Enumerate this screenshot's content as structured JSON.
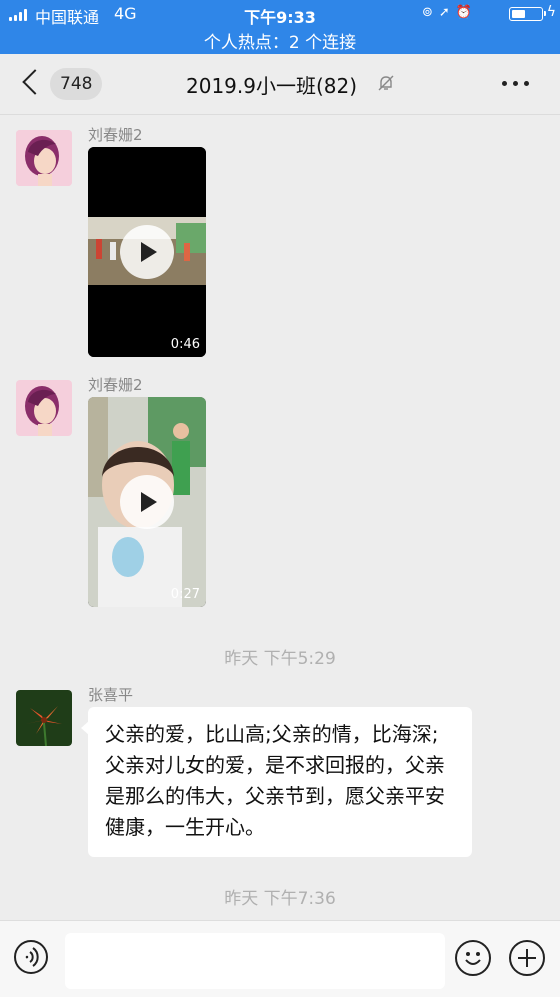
{
  "status_bar": {
    "carrier": "中国联通",
    "network": "4G",
    "time": "下午9:33",
    "hotspot": "个人热点：2 个连接"
  },
  "nav": {
    "unread_count": "748",
    "title": "2019.9小一班(82)"
  },
  "messages": [
    {
      "type": "video",
      "sender": "刘春姗2",
      "duration": "0:46"
    },
    {
      "type": "video",
      "sender": "刘春姗2",
      "duration": "0:27"
    },
    {
      "type": "timestamp",
      "text": "昨天 下午5:29"
    },
    {
      "type": "text",
      "sender": "张喜平",
      "text": "父亲的爱，比山高;父亲的情，比海深;父亲对儿女的爱，是不求回报的，父亲是那么的伟大，父亲节到，愿父亲平安健康，一生开心。"
    },
    {
      "type": "timestamp",
      "text": "昨天 下午7:36"
    }
  ],
  "icons": {
    "back": "chevron-left-icon",
    "mute": "bell-off-icon",
    "more": "more-dots-icon",
    "voice": "voice-icon",
    "emoji": "emoji-icon",
    "add": "plus-icon"
  },
  "colors": {
    "status_bar": "#2f86e8",
    "background": "#ededed",
    "bubble": "#ffffff",
    "timestamp": "#b0b0b0"
  }
}
